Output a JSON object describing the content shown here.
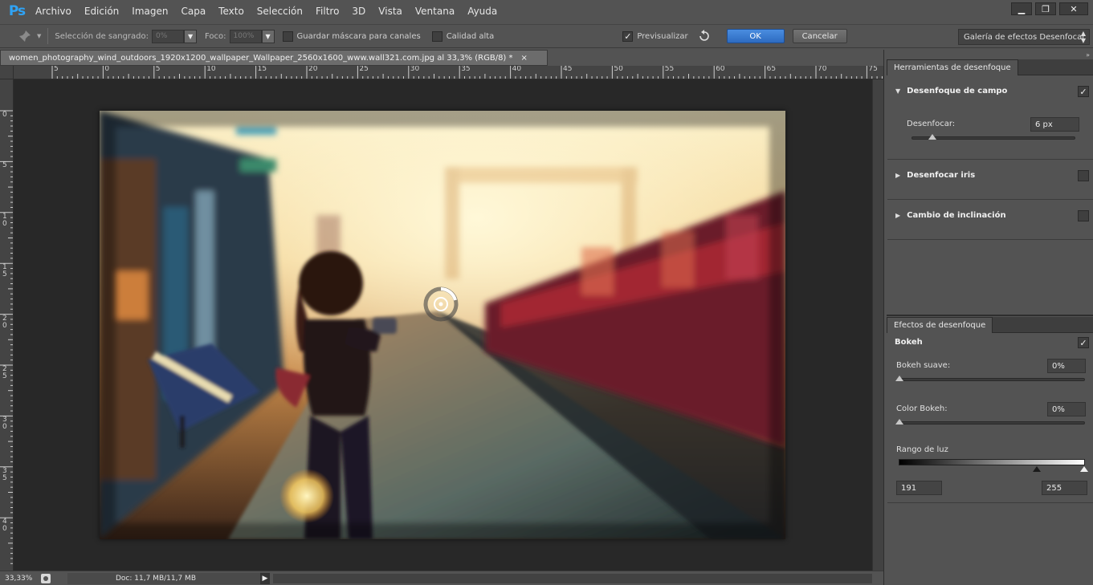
{
  "app": {
    "logo": "Ps",
    "menu": [
      "Archivo",
      "Edición",
      "Imagen",
      "Capa",
      "Texto",
      "Selección",
      "Filtro",
      "3D",
      "Vista",
      "Ventana",
      "Ayuda"
    ],
    "window_controls": {
      "minimize": "▁",
      "restore": "❐",
      "close": "✕"
    }
  },
  "options": {
    "bleed_label": "Selección de sangrado:",
    "bleed_value": "0%",
    "focus_label": "Foco:",
    "focus_value": "100%",
    "save_mask_label": "Guardar máscara para canales",
    "high_quality_label": "Calidad alta",
    "preview_label": "Previsualizar",
    "preview_checked": "✓",
    "ok_label": "OK",
    "cancel_label": "Cancelar",
    "gallery_label": "Galería de efectos Desenfocar"
  },
  "document": {
    "tab_title": "women_photography_wind_outdoors_1920x1200_wallpaper_Wallpaper_2560x1600_www.wall321.com.jpg al 33,3% (RGB/8) *",
    "close": "×"
  },
  "rulers": {
    "top": [
      "5",
      "0",
      "5",
      "10",
      "15",
      "20",
      "25",
      "30",
      "35",
      "40",
      "45",
      "50",
      "55",
      "60",
      "65",
      "70",
      "75"
    ],
    "left": [
      "0",
      "5",
      "10",
      "15",
      "20",
      "25",
      "30",
      "35",
      "40"
    ]
  },
  "status": {
    "zoom": "33,33%",
    "doc": "Doc: 11,7 MB/11,7 MB",
    "arrow": "▶"
  },
  "blur_tools": {
    "tab": "Herramientas de desenfoque",
    "field_blur": {
      "label": "Desenfoque de campo",
      "checked": "✓",
      "blur_label": "Desenfocar:",
      "blur_value": "6 px"
    },
    "iris_blur": {
      "label": "Desenfocar iris"
    },
    "tilt_shift": {
      "label": "Cambio de inclinación"
    },
    "expanded_tri": "▼",
    "collapsed_tri": "▶"
  },
  "blur_effects": {
    "tab": "Efectos de desenfoque",
    "bokeh_label": "Bokeh",
    "bokeh_checked": "✓",
    "soft_bokeh_label": "Bokeh suave:",
    "soft_bokeh_value": "0%",
    "bokeh_color_label": "Color Bokeh:",
    "bokeh_color_value": "0%",
    "light_range_label": "Rango de luz",
    "light_range_low": "191",
    "light_range_high": "255"
  }
}
